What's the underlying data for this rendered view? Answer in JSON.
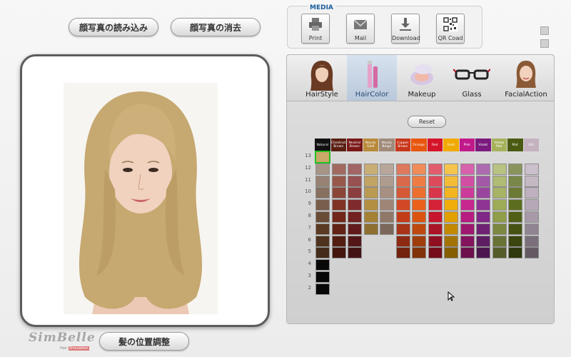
{
  "top_buttons": {
    "load_photo": "顔写真の読み込み",
    "clear_photo": "顔写真の消去"
  },
  "bottom_button": "髪の位置調整",
  "media": {
    "title": "MEDIA",
    "buttons": [
      {
        "label": "Print",
        "icon": "printer-icon"
      },
      {
        "label": "Mail",
        "icon": "mail-icon"
      },
      {
        "label": "Download",
        "icon": "download-icon"
      },
      {
        "label": "QR Coad",
        "icon": "qr-code-icon"
      }
    ]
  },
  "tabs": [
    {
      "label": "HairStyle",
      "icon": "hairstyle-icon",
      "active": false
    },
    {
      "label": "HairColor",
      "icon": "haircolor-icon",
      "active": true
    },
    {
      "label": "Makeup",
      "icon": "makeup-icon",
      "active": false
    },
    {
      "label": "Glass",
      "icon": "glasses-icon",
      "active": false
    },
    {
      "label": "FacialAction",
      "icon": "facial-action-icon",
      "active": false
    }
  ],
  "reset_label": "Reset",
  "color_columns": [
    {
      "label": "Natural",
      "header_bg": "#111111",
      "header_fg": "#ffffff",
      "base": "#5a3a22"
    },
    {
      "label": "Chestnut Brown",
      "header_bg": "#5a1e12",
      "header_fg": "#ffffff",
      "base": "#7a2a1a"
    },
    {
      "label": "Neutral Brown",
      "header_bg": "#7a1818",
      "header_fg": "#ffffff",
      "base": "#7a2222"
    },
    {
      "label": "Neudy Gold",
      "header_bg": "#b88a3a",
      "header_fg": "#ffffff",
      "base": "#b08a3a"
    },
    {
      "label": "Neudy Beige",
      "header_bg": "#a08a7a",
      "header_fg": "#ffffff",
      "base": "#9a8070"
    },
    {
      "label": "Copper Brown",
      "header_bg": "#c8361a",
      "header_fg": "#ffffff",
      "base": "#d0401a"
    },
    {
      "label": "Orange",
      "header_bg": "#e8560f",
      "header_fg": "#ffffff",
      "base": "#ea5a10"
    },
    {
      "label": "Red",
      "header_bg": "#d4142a",
      "header_fg": "#ffffff",
      "base": "#d41830"
    },
    {
      "label": "Gold",
      "header_bg": "#f0aa00",
      "header_fg": "#ffffff",
      "base": "#f0aa00"
    },
    {
      "label": "Pink",
      "header_bg": "#c01a8a",
      "header_fg": "#ffffff",
      "base": "#c41e8a"
    },
    {
      "label": "Violet",
      "header_bg": "#7a1a7e",
      "header_fg": "#ffffff",
      "base": "#8a2a90"
    },
    {
      "label": "Yellow Mat",
      "header_bg": "#a6b25a",
      "header_fg": "#ffffff",
      "base": "#9aa84e"
    },
    {
      "label": "Mat",
      "header_bg": "#4a5a12",
      "header_fg": "#ffffff",
      "base": "#556616"
    },
    {
      "label": "Ash",
      "header_bg": "#c4b2c0",
      "header_fg": "#ffffff",
      "base": "#b4a4b4"
    }
  ],
  "levels": [
    "13",
    "12",
    "11",
    "10",
    "9",
    "8",
    "7",
    "6",
    "5",
    "4",
    "3",
    "2"
  ],
  "grid_rows": [
    {
      "level": "13",
      "columns": [
        0
      ]
    },
    {
      "level": "12",
      "columns": [
        0,
        1,
        2,
        3,
        4,
        5,
        6,
        7,
        8,
        9,
        10,
        11,
        12,
        13
      ]
    },
    {
      "level": "11",
      "columns": [
        0,
        1,
        2,
        3,
        4,
        5,
        6,
        7,
        8,
        9,
        10,
        11,
        12,
        13
      ]
    },
    {
      "level": "10",
      "columns": [
        0,
        1,
        2,
        3,
        4,
        5,
        6,
        7,
        8,
        9,
        10,
        11,
        12,
        13
      ]
    },
    {
      "level": "9",
      "columns": [
        0,
        1,
        2,
        3,
        4,
        5,
        6,
        7,
        8,
        9,
        10,
        11,
        12,
        13
      ]
    },
    {
      "level": "8",
      "columns": [
        0,
        1,
        2,
        3,
        4,
        5,
        6,
        7,
        8,
        9,
        10,
        11,
        12,
        13
      ]
    },
    {
      "level": "7",
      "columns": [
        0,
        1,
        2,
        3,
        4,
        5,
        6,
        7,
        8,
        9,
        10,
        11,
        12,
        13
      ]
    },
    {
      "level": "6",
      "columns": [
        0,
        1,
        2,
        5,
        6,
        7,
        8,
        9,
        10,
        11,
        12,
        13
      ]
    },
    {
      "level": "5",
      "columns": [
        0,
        1,
        2,
        5,
        6,
        7,
        8,
        9,
        10,
        11,
        12,
        13
      ]
    },
    {
      "level": "4",
      "columns": [
        0
      ]
    },
    {
      "level": "3",
      "columns": [
        0
      ]
    },
    {
      "level": "2",
      "columns": [
        0
      ]
    }
  ],
  "selected_swatch": {
    "level": "13",
    "column": "Natural",
    "color": "#c9a968"
  },
  "logo": {
    "name": "SimBelle",
    "sub_left": "Hair",
    "sub_right": "Simulation"
  },
  "colors": {
    "accent": "#1b5f9e",
    "selection": "#22c022",
    "hair": "#c9ad76"
  }
}
